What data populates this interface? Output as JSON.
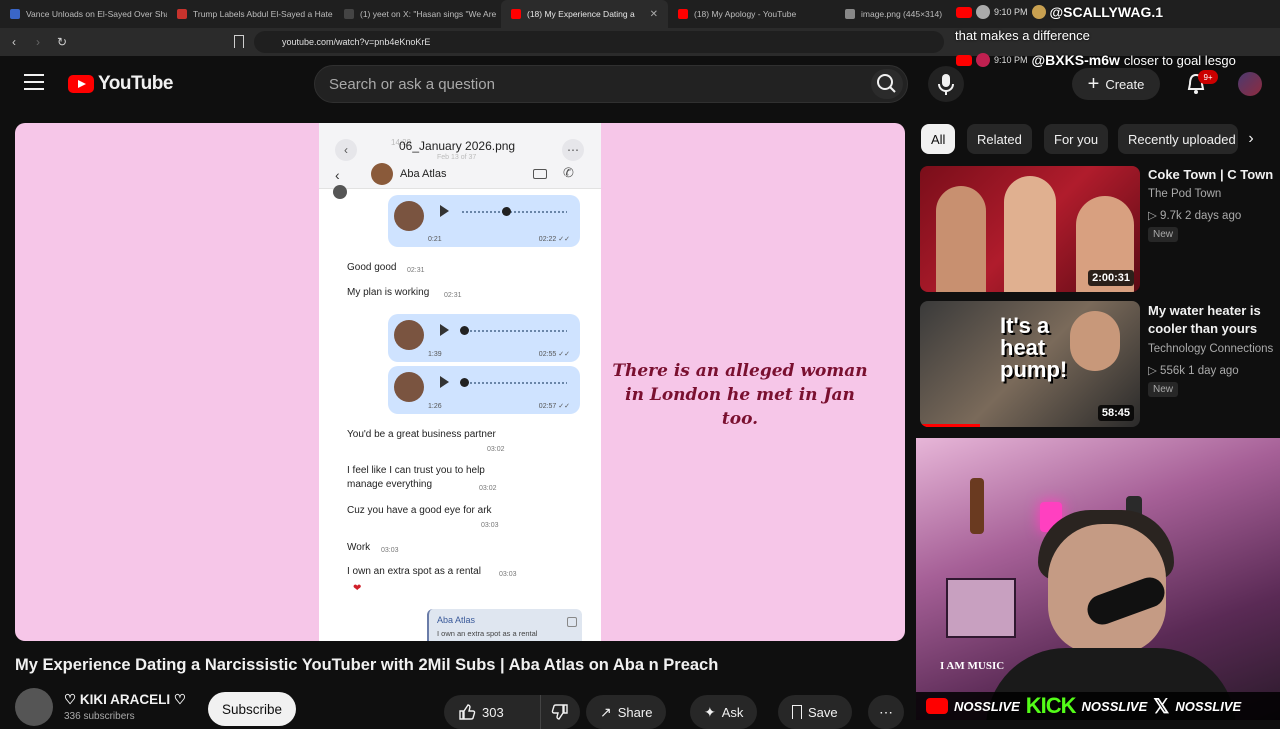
{
  "browser": {
    "tabs": [
      {
        "title": "Vance Unloads on El-Sayed Over Sha",
        "color": "#3a66c7"
      },
      {
        "title": "Trump Labels Abdul El-Sayed a Hate",
        "color": "#c7332d"
      },
      {
        "title": "(1) yeet on X: \"Hasan sings \"We Are",
        "color": "#dddddd"
      },
      {
        "title": "(18) My Experience Dating a",
        "color": "#ff0000",
        "active": true
      },
      {
        "title": "(18) My Apology - YouTube",
        "color": "#ff0000"
      },
      {
        "title": "image.png (445×314)",
        "color": "#888888"
      }
    ],
    "tab_close": "✕",
    "url": "youtube.com/watch?v=pnb4eKnoKrE"
  },
  "header": {
    "logo_text": "YouTube",
    "search_placeholder": "Search or ask a question",
    "create_label": "Create",
    "notifications": "9+"
  },
  "chat_overlay": [
    {
      "time": "9:10 PM",
      "user": "@SCALLYWAG.1",
      "message": "that makes a difference",
      "badge": "#ff0000"
    },
    {
      "time": "9:10 PM",
      "user": "@BXKS-m6w",
      "message": "closer to goal lesgo",
      "badge": "#ff0000"
    }
  ],
  "video": {
    "phone": {
      "time": "14:29",
      "file_name": "06_January 2026.png",
      "file_sub": "Feb 13 of 37",
      "contact": "Aba Atlas",
      "voice_notes": [
        {
          "duration": "0:21",
          "time": "02:22 ✓✓"
        },
        {
          "duration": "1:39",
          "time": "02:55 ✓✓"
        },
        {
          "duration": "1:26",
          "time": "02:57 ✓✓"
        }
      ],
      "messages": [
        {
          "text": "Good good",
          "time": "02:31"
        },
        {
          "text": "My plan is working",
          "time": "02:31"
        },
        {
          "text": "You'd be a great business partner",
          "time": "03:02"
        },
        {
          "text": "I feel like I can trust you to help",
          "text2": "manage everything",
          "time": "03:02"
        },
        {
          "text": "Cuz you have a good eye for ark",
          "time": "03:03"
        },
        {
          "text": "Work",
          "time": "03:03"
        },
        {
          "text": "I own an extra spot as a rental",
          "time": "03:03"
        }
      ],
      "reaction": "❤",
      "quote_name": "Aba Atlas",
      "quote_text": "I own an extra spot as a rental"
    },
    "caption_line1": "There is an alleged woman",
    "caption_line2": "in London he met in Jan too.",
    "title": "My Experience Dating a Narcissistic YouTuber with 2Mil Subs | Aba Atlas on Aba n Preach",
    "channel": "♡ KIKI ARACELI ♡",
    "subscribers": "336 subscribers",
    "subscribe_label": "Subscribe",
    "likes": "303",
    "share_label": "Share",
    "ask_label": "Ask",
    "save_label": "Save"
  },
  "chips": [
    "All",
    "Related",
    "For you",
    "Recently uploaded"
  ],
  "recommendations": [
    {
      "title": "Coke Town | C Town",
      "channel": "The Pod Town",
      "meta": "9.7k  2 days ago",
      "badge": "New",
      "duration": "2:00:31"
    },
    {
      "title": "My water heater is cooler than yours",
      "channel": "Technology Connections",
      "meta": "556k  1 day ago",
      "badge": "New",
      "duration": "58:45",
      "thumb_text": "It's a heat pump!"
    }
  ],
  "webcam": {
    "sign": "I AM MUSIC",
    "socials": [
      "NOSSLIVE",
      "KICK",
      "NOSSLIVE",
      "NOSSLIVE"
    ]
  }
}
